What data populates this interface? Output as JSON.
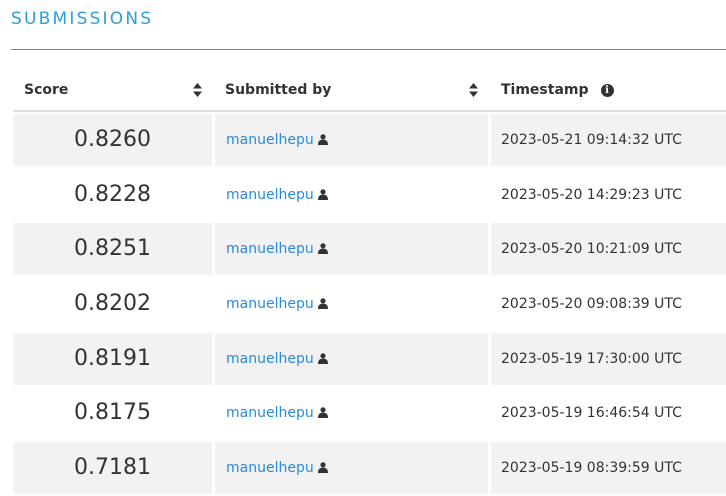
{
  "heading": "SUBMISSIONS",
  "columns": {
    "score": "Score",
    "submitted_by": "Submitted by",
    "timestamp": "Timestamp"
  },
  "icons": {
    "sort": "sort-icon",
    "info": "info-icon",
    "user": "user-icon"
  },
  "colors": {
    "accent": "#2a9fd8",
    "link": "#2a8ad8",
    "row_shade": "#f2f2f2"
  },
  "rows": [
    {
      "score": "0.8260",
      "user": "manuelhepu",
      "timestamp": "2023-05-21 09:14:32 UTC"
    },
    {
      "score": "0.8228",
      "user": "manuelhepu",
      "timestamp": "2023-05-20 14:29:23 UTC"
    },
    {
      "score": "0.8251",
      "user": "manuelhepu",
      "timestamp": "2023-05-20 10:21:09 UTC"
    },
    {
      "score": "0.8202",
      "user": "manuelhepu",
      "timestamp": "2023-05-20 09:08:39 UTC"
    },
    {
      "score": "0.8191",
      "user": "manuelhepu",
      "timestamp": "2023-05-19 17:30:00 UTC"
    },
    {
      "score": "0.8175",
      "user": "manuelhepu",
      "timestamp": "2023-05-19 16:46:54 UTC"
    },
    {
      "score": "0.7181",
      "user": "manuelhepu",
      "timestamp": "2023-05-19 08:39:59 UTC"
    }
  ]
}
